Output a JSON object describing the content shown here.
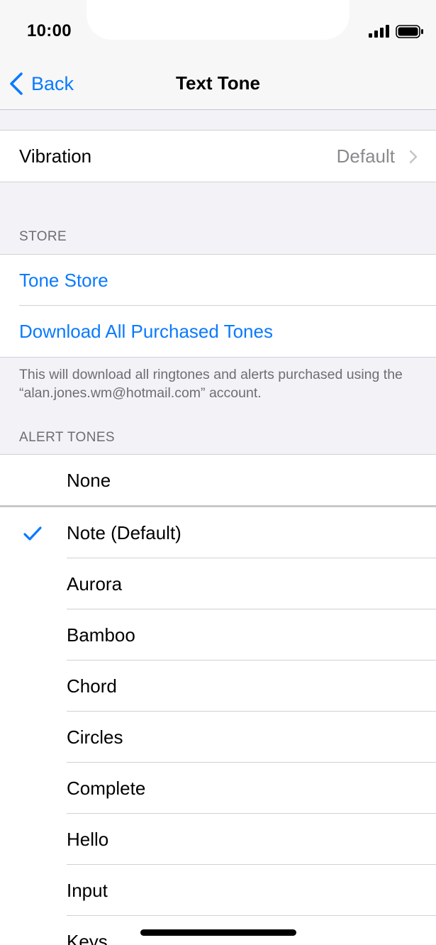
{
  "status_bar": {
    "time": "10:00"
  },
  "nav": {
    "back_label": "Back",
    "title": "Text Tone"
  },
  "vibration": {
    "label": "Vibration",
    "value": "Default"
  },
  "store": {
    "header": "STORE",
    "tone_store": "Tone Store",
    "download_all": "Download All Purchased Tones",
    "footer": "This will download all ringtones and alerts purchased using the “alan.jones.wm@hotmail.com” account."
  },
  "alert_tones": {
    "header": "ALERT TONES",
    "none_label": "None",
    "selected": "Note (Default)",
    "items": [
      "Note (Default)",
      "Aurora",
      "Bamboo",
      "Chord",
      "Circles",
      "Complete",
      "Hello",
      "Input",
      "Keys"
    ]
  },
  "colors": {
    "accent": "#0a7aff",
    "background": "#f2f2f7",
    "secondary_text": "#8a8a8e"
  }
}
